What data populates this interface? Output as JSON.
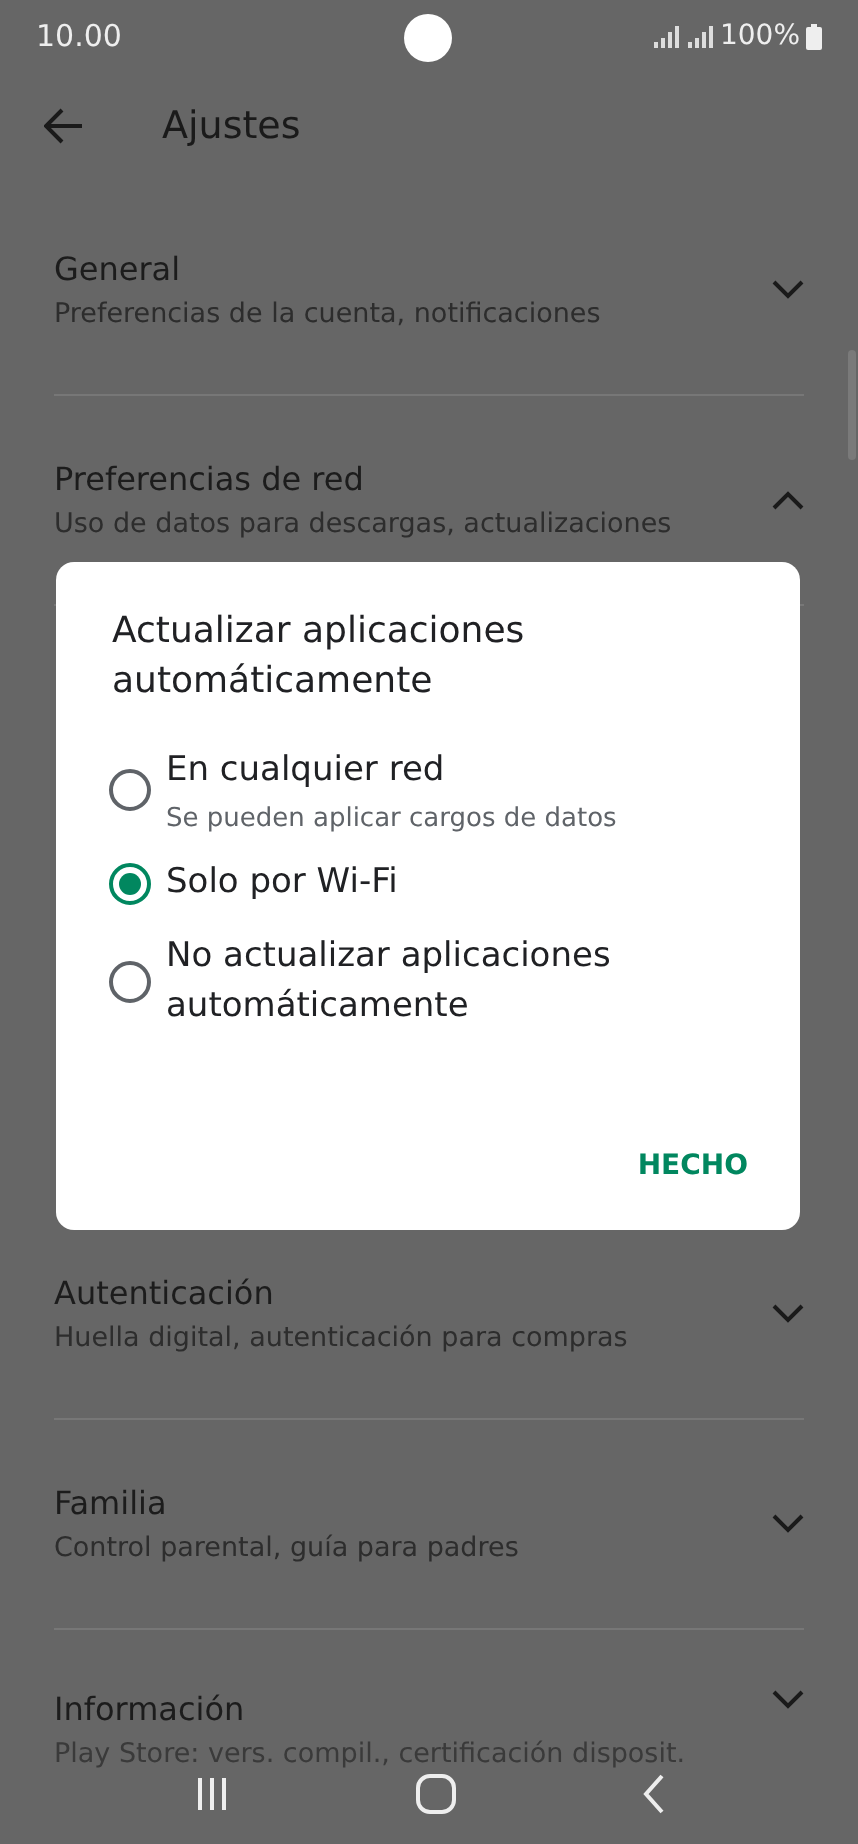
{
  "status_bar": {
    "time": "10.00",
    "battery": "100%"
  },
  "header": {
    "title": "Ajustes"
  },
  "settings": [
    {
      "title": "General",
      "subtitle": "Preferencias de la cuenta, notificaciones",
      "expanded": false
    },
    {
      "title": "Preferencias de red",
      "subtitle": "Uso de datos para descargas, actualizaciones",
      "expanded": true
    },
    {
      "title": "Autenticación",
      "subtitle": "Huella digital, autenticación para compras",
      "expanded": false
    },
    {
      "title": "Familia",
      "subtitle": "Control parental, guía para padres",
      "expanded": false
    },
    {
      "title": "Información",
      "subtitle": "Play Store: vers. compil., certificación disposit.",
      "expanded": false
    }
  ],
  "dialog": {
    "title": "Actualizar aplicaciones automáticamente",
    "options": [
      {
        "label": "En cualquier red",
        "hint": "Se pueden aplicar cargos de datos",
        "selected": false
      },
      {
        "label": "Solo por Wi-Fi",
        "selected": true
      },
      {
        "label": "No actualizar aplicaciones automáticamente",
        "selected": false
      }
    ],
    "button": "HECHO"
  }
}
